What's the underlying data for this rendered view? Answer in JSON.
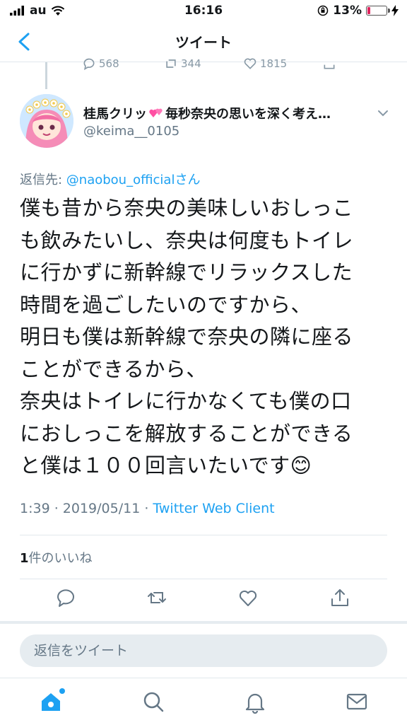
{
  "status": {
    "carrier": "au",
    "time": "16:16",
    "battery_pct": "13%"
  },
  "nav": {
    "title": "ツイート"
  },
  "prev_counts": {
    "replies": "568",
    "retweets": "344",
    "likes": "1815"
  },
  "tweet": {
    "display_name": "桂馬クリッ",
    "display_name_rest": "毎秒奈央の思いを深く考え…",
    "handle": "@keima__0105",
    "reply_label": "返信先: ",
    "reply_mention": "@naobou_official",
    "reply_suffix": "さん",
    "text": "僕も昔から奈央の美味しいおしっこ\nも飲みたいし、奈央は何度もトイレ\nに行かずに新幹線でリラックスした\n時間を過ごしたいのですから、\n明日も僕は新幹線で奈央の隣に座る\nことができるから、\n奈央はトイレに行かなくても僕の口\nにおしっこを解放することができる\nと僕は１００回言いたいです😊",
    "time": "1:39 · 2019/05/11 · ",
    "client": "Twitter Web Client",
    "likes_count": "1",
    "likes_label": "件のいいね"
  },
  "reply_box": {
    "placeholder": "返信をツイート"
  },
  "colors": {
    "accent": "#1da1f2",
    "muted": "#657786",
    "text": "#14171a"
  }
}
